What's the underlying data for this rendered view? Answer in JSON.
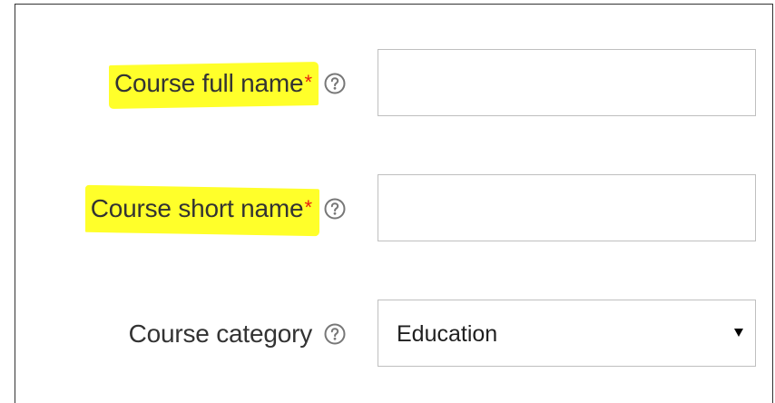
{
  "form": {
    "full_name": {
      "label": "Course full name",
      "required_mark": "*",
      "value": "",
      "help_icon": "question-circle-icon",
      "highlight_color": "#ffff2a"
    },
    "short_name": {
      "label": "Course short name",
      "required_mark": "*",
      "value": "",
      "help_icon": "question-circle-icon",
      "highlight_color": "#ffff2a"
    },
    "category": {
      "label": "Course category",
      "selected": "Education",
      "help_icon": "question-circle-icon",
      "arrow_icon": "dropdown-triangle-icon"
    }
  },
  "colors": {
    "required": "#e81e10",
    "label_text": "#333333",
    "input_border": "#bfbfbf",
    "help_icon": "#777777"
  }
}
